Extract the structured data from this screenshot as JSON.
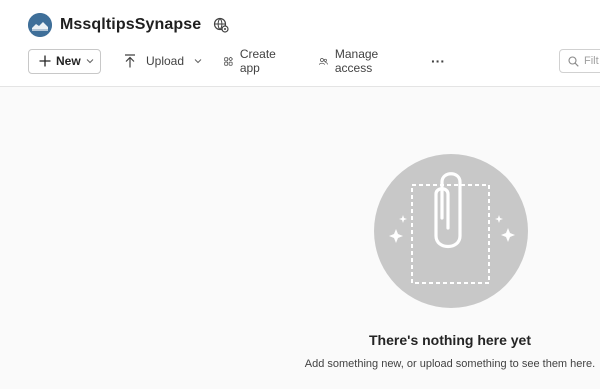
{
  "workspace": {
    "title": "MssqltipsSynapse",
    "avatar_icon": "workspace-logo-icon",
    "settings_icon": "workspace-settings-icon",
    "avatar_color": "#3f6f99"
  },
  "toolbar": {
    "new_label": "New",
    "upload_label": "Upload",
    "create_app_label": "Create app",
    "manage_access_label": "Manage access",
    "more_label": "···"
  },
  "filter": {
    "placeholder": "Filt"
  },
  "empty_state": {
    "title": "There's nothing here yet",
    "subtitle": "Add something new, or upload something to see them here.",
    "illustration_icon": "paperclip-icon",
    "circle_color": "#c8c8c8"
  }
}
